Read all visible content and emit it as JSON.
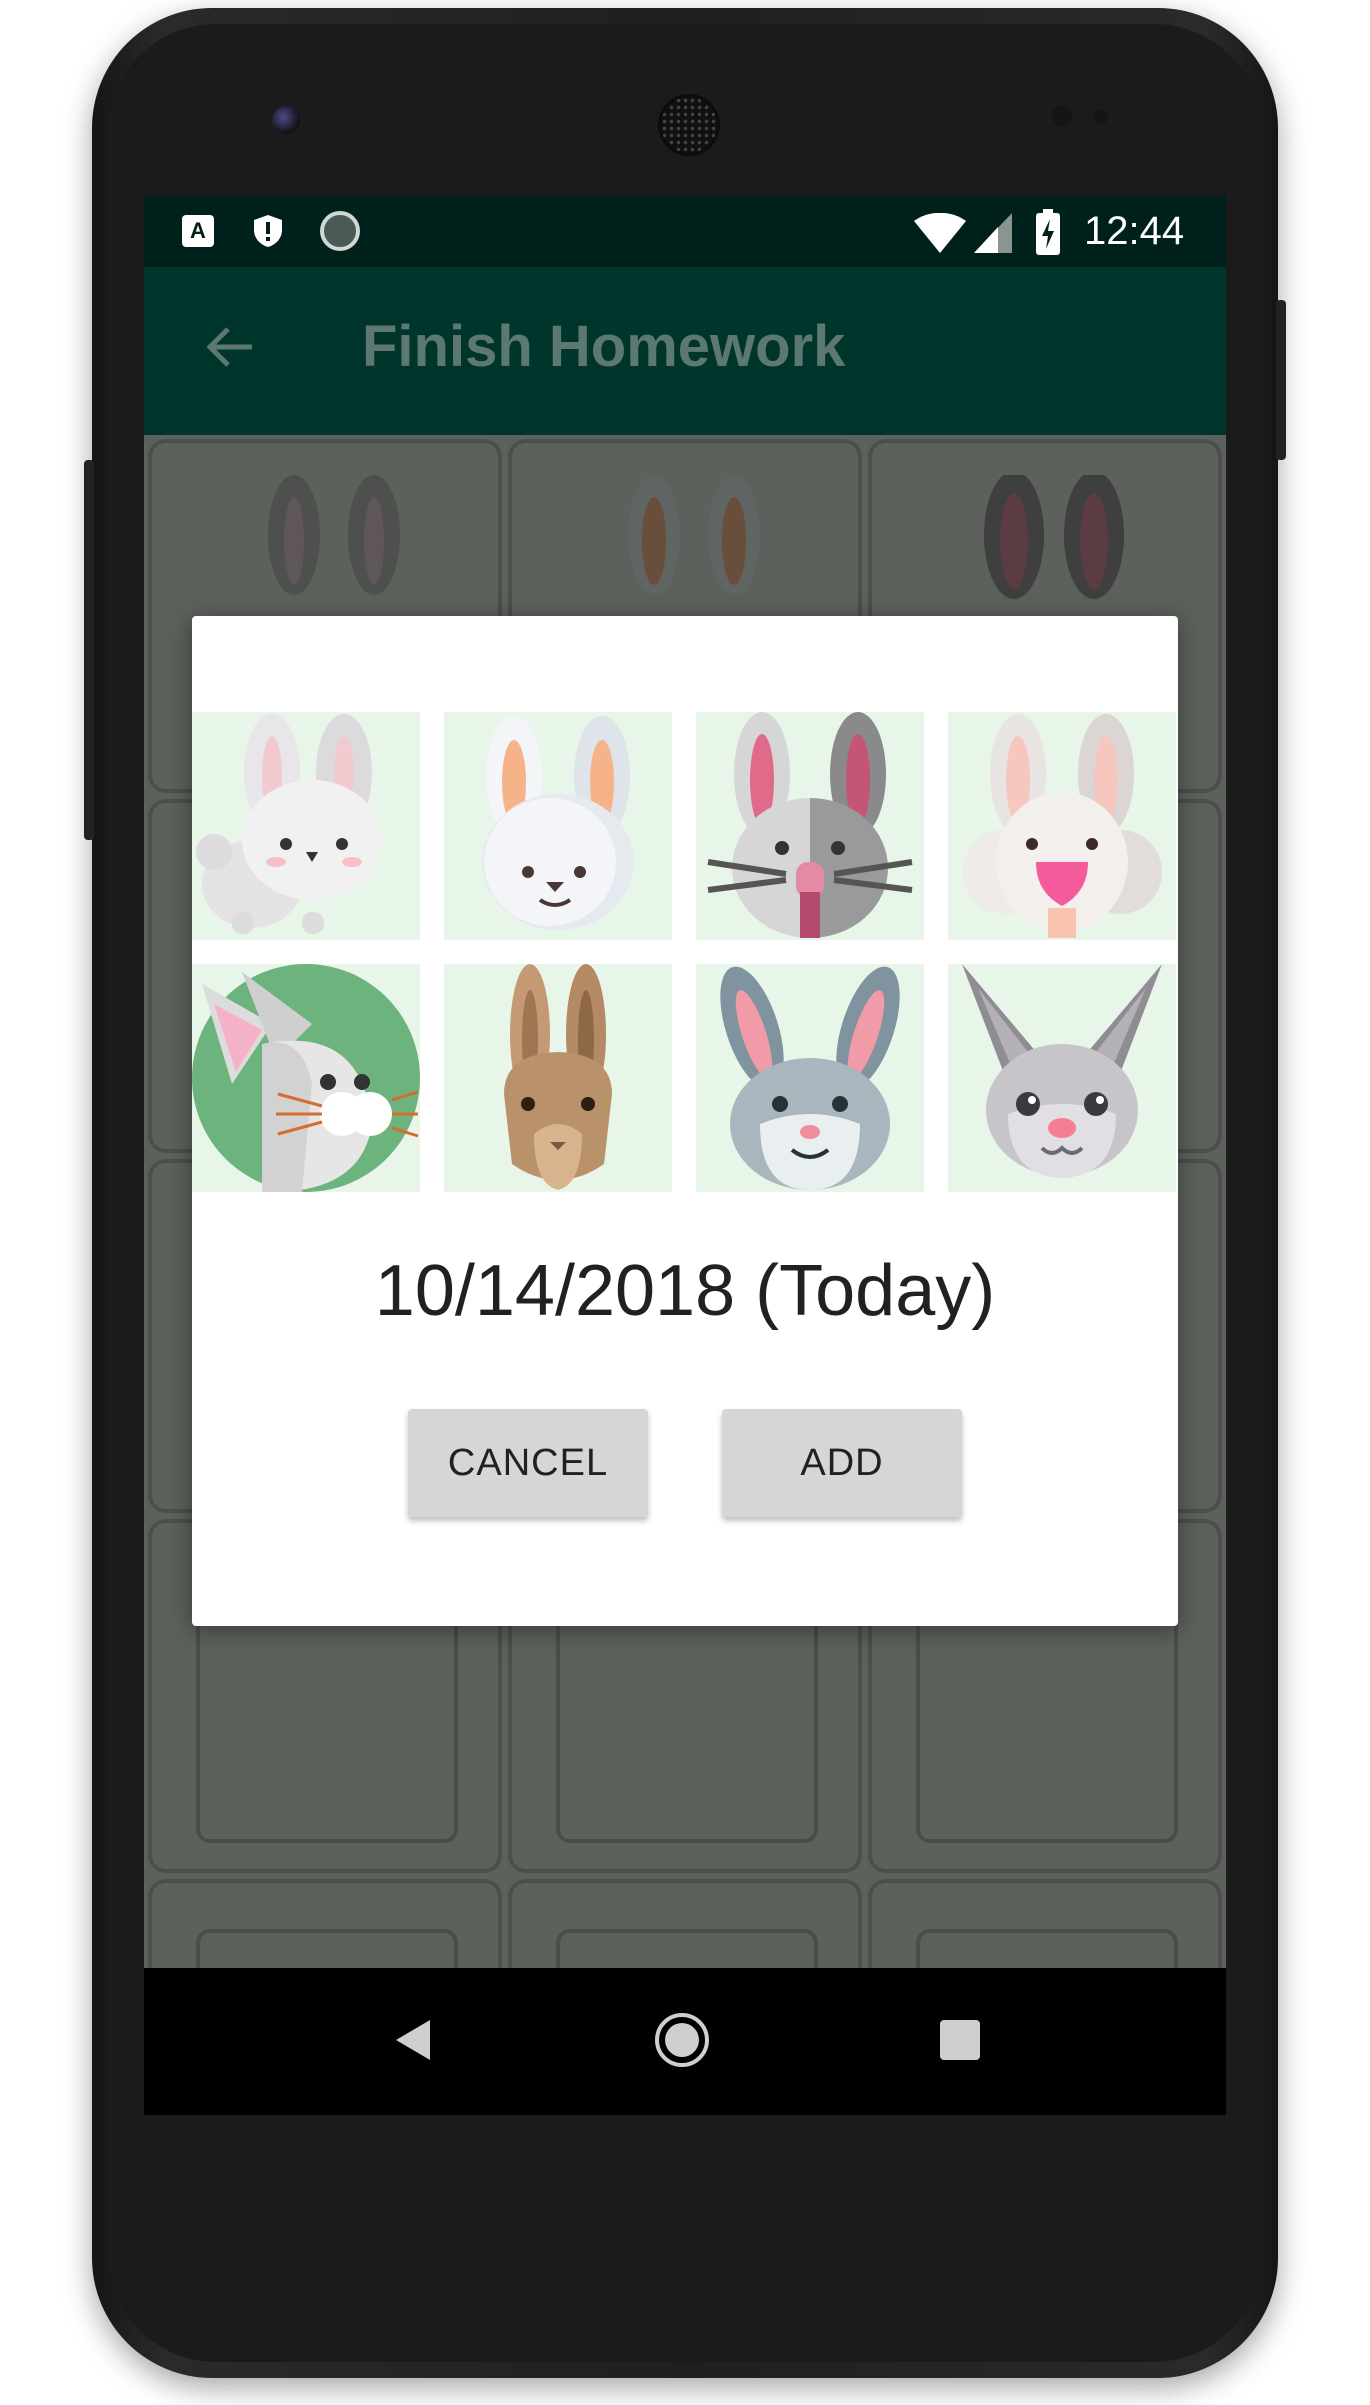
{
  "status_bar": {
    "time": "12:44",
    "left_icons": [
      "a-notification-icon",
      "shield-icon",
      "sync-icon"
    ],
    "right_icons": [
      "wifi-icon",
      "signal-icon",
      "battery-icon"
    ],
    "a_icon_glyph": "A"
  },
  "toolbar": {
    "title": "Finish Homework",
    "back_icon": "back-arrow-icon",
    "background_color": "#00352c"
  },
  "dialog": {
    "bunnies": [
      {
        "name": "bunny-1"
      },
      {
        "name": "bunny-2"
      },
      {
        "name": "bunny-3"
      },
      {
        "name": "bunny-4"
      },
      {
        "name": "bunny-5"
      },
      {
        "name": "bunny-6"
      },
      {
        "name": "bunny-7"
      },
      {
        "name": "bunny-8"
      }
    ],
    "date_text": "10/14/2018 (Today)",
    "cancel_label": "CANCEL",
    "add_label": "ADD"
  },
  "nav_bar": {
    "icons": [
      "nav-back-icon",
      "nav-home-icon",
      "nav-recents-icon"
    ]
  },
  "colors": {
    "status_bar": "#00211b",
    "tile_background": "#e8f5e9",
    "scrim": "#5c615b"
  }
}
